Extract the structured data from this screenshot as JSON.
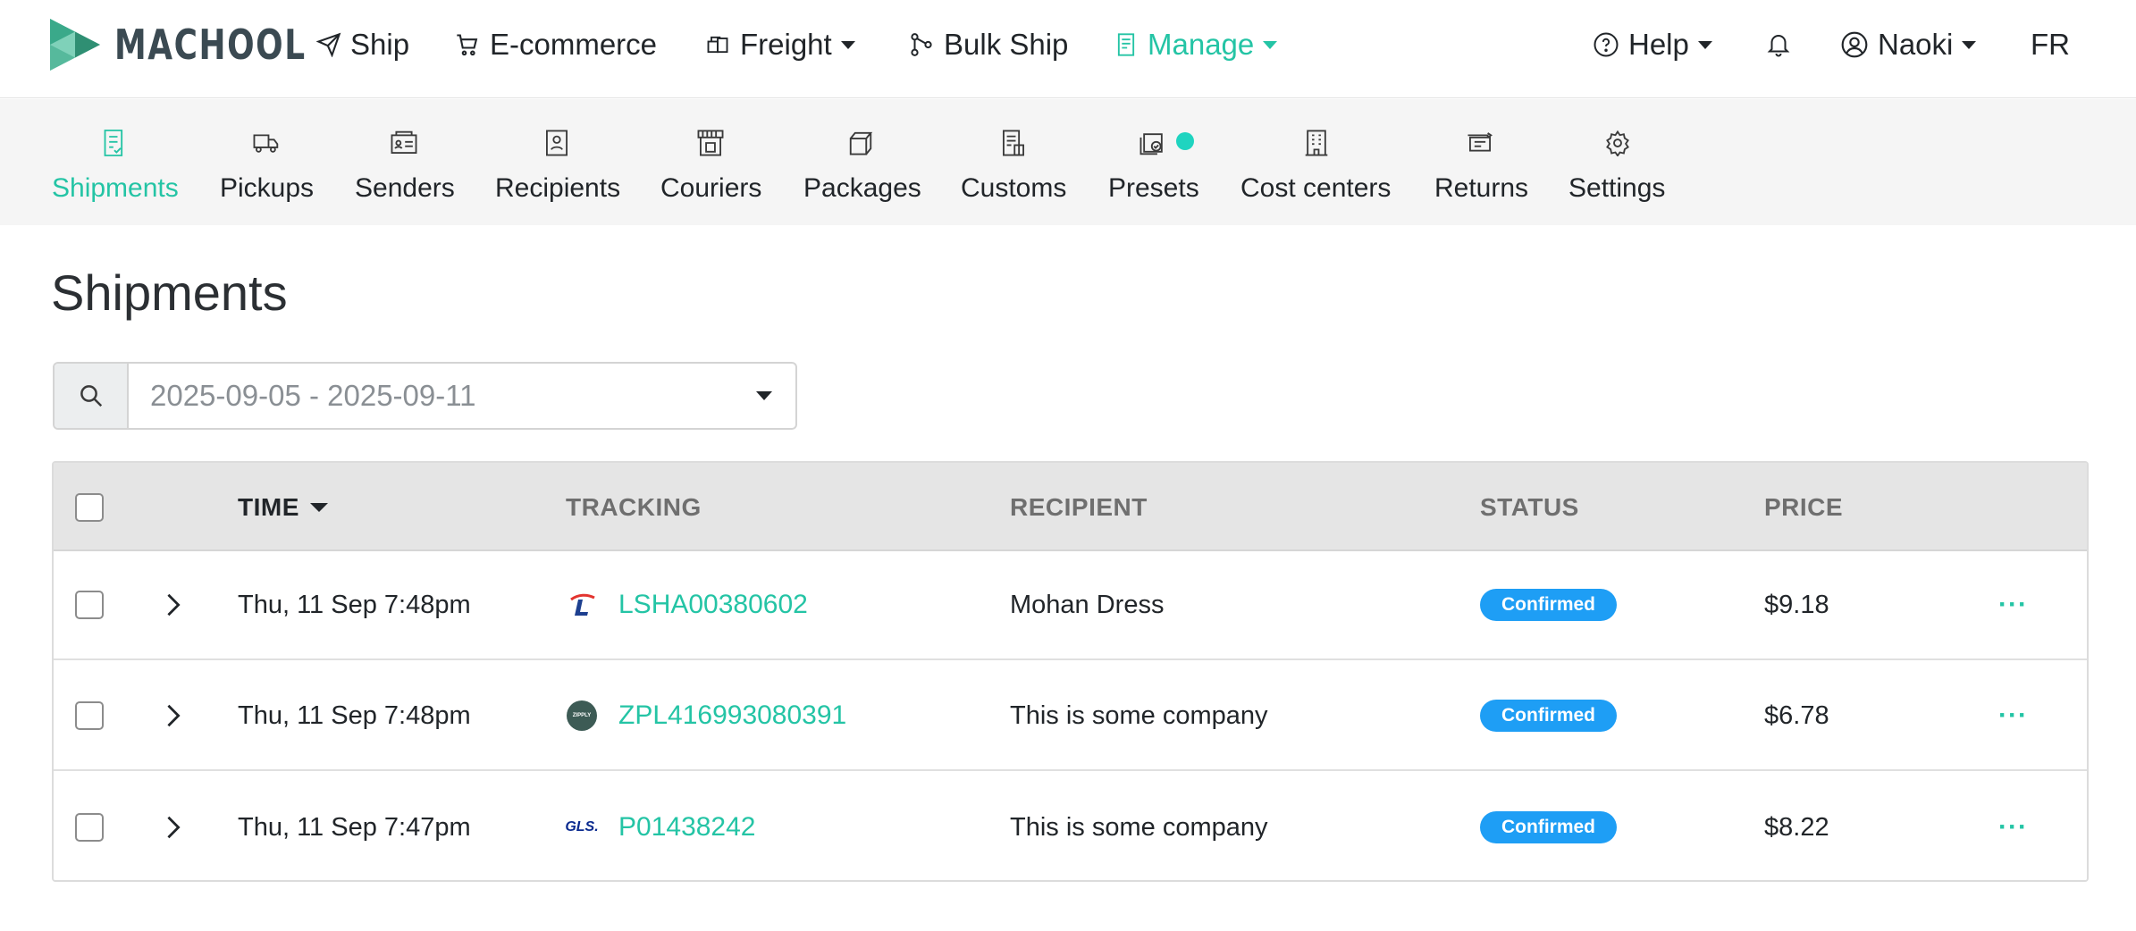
{
  "brand": {
    "name": "MACHOOL",
    "accent": "#24c4a5"
  },
  "topnav": {
    "items": [
      {
        "label": "Ship",
        "icon": "paper-plane-icon"
      },
      {
        "label": "E-commerce",
        "icon": "cart-icon"
      },
      {
        "label": "Freight",
        "icon": "boxes-icon",
        "dropdown": true
      },
      {
        "label": "Bulk Ship",
        "icon": "nodes-icon"
      },
      {
        "label": "Manage",
        "icon": "document-icon",
        "dropdown": true,
        "active": true
      }
    ],
    "help": "Help",
    "user": "Naoki",
    "language": "FR"
  },
  "subnav": {
    "items": [
      {
        "label": "Shipments",
        "icon": "shipments-icon",
        "active": true
      },
      {
        "label": "Pickups",
        "icon": "truck-icon"
      },
      {
        "label": "Senders",
        "icon": "id-card-icon"
      },
      {
        "label": "Recipients",
        "icon": "user-card-icon"
      },
      {
        "label": "Couriers",
        "icon": "store-icon"
      },
      {
        "label": "Packages",
        "icon": "package-icon"
      },
      {
        "label": "Customs",
        "icon": "customs-doc-icon"
      },
      {
        "label": "Presets",
        "icon": "presets-icon",
        "indicator": true
      },
      {
        "label": "Cost centers",
        "icon": "building-icon"
      },
      {
        "label": "Returns",
        "icon": "returns-icon"
      },
      {
        "label": "Settings",
        "icon": "gear-icon"
      }
    ]
  },
  "page": {
    "title": "Shipments",
    "date_range": "2025-09-05 - 2025-09-11"
  },
  "table": {
    "headers": {
      "time": "TIME",
      "tracking": "TRACKING",
      "recipient": "RECIPIENT",
      "status": "STATUS",
      "price": "PRICE"
    },
    "rows": [
      {
        "time": "Thu, 11 Sep 7:48pm",
        "courier": "loomis-logo",
        "tracking": "LSHA00380602",
        "recipient": "Mohan Dress",
        "status": "Confirmed",
        "price": "$9.18",
        "more": "···"
      },
      {
        "time": "Thu, 11 Sep 7:48pm",
        "courier": "zipply-logo",
        "courier_text": "ZIPPLY",
        "tracking": "ZPL416993080391",
        "recipient": "This is some company",
        "status": "Confirmed",
        "price": "$6.78",
        "more": "···"
      },
      {
        "time": "Thu, 11 Sep 7:47pm",
        "courier": "gls-logo",
        "courier_text": "GLS.",
        "tracking": "P01438242",
        "recipient": "This is some company",
        "status": "Confirmed",
        "price": "$8.22",
        "more": "···"
      }
    ]
  },
  "colors": {
    "status_confirmed": "#1e9ef5",
    "link": "#24c4a5",
    "presets_dot": "#1fd4c0"
  }
}
